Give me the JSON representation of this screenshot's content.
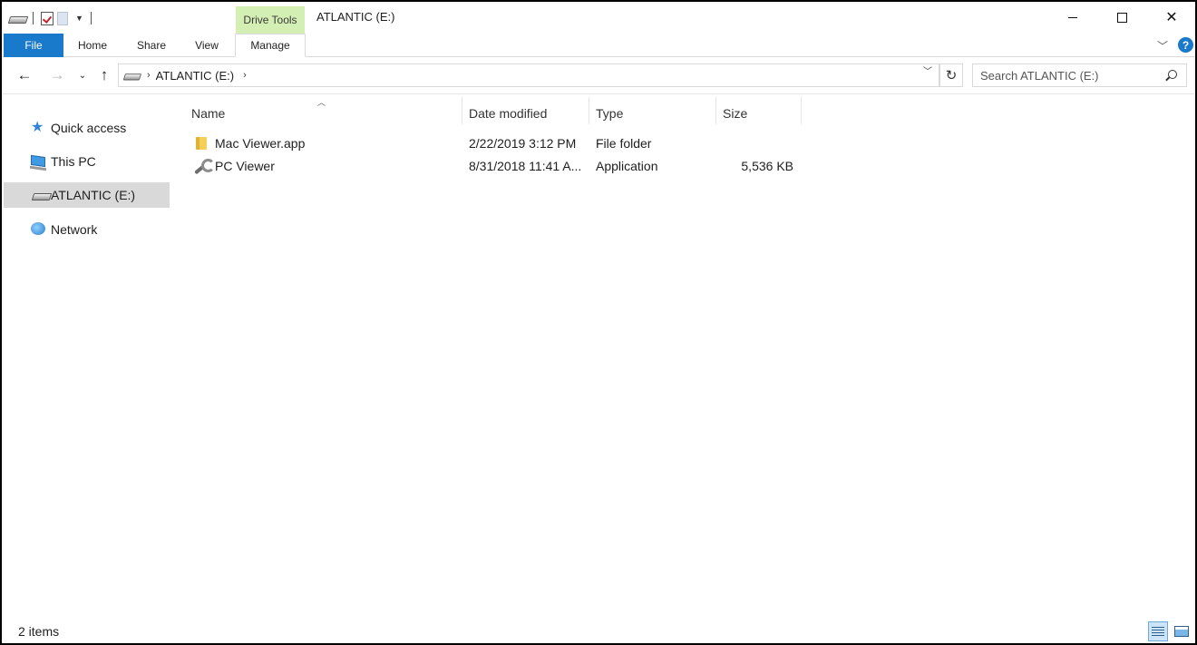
{
  "titlebar": {
    "context_tab": "Drive Tools",
    "window_title": "ATLANTIC (E:)"
  },
  "ribbon": {
    "tabs": [
      {
        "label": "File"
      },
      {
        "label": "Home"
      },
      {
        "label": "Share"
      },
      {
        "label": "View"
      },
      {
        "label": "Manage"
      }
    ],
    "help_label": "?"
  },
  "address": {
    "path": [
      "ATLANTIC (E:)"
    ],
    "search_placeholder": "Search ATLANTIC (E:)"
  },
  "nav_pane": {
    "items": [
      {
        "label": "Quick access",
        "icon": "star-icon"
      },
      {
        "label": "This PC",
        "icon": "computer-icon"
      },
      {
        "label": "ATLANTIC (E:)",
        "icon": "drive-icon",
        "selected": true
      },
      {
        "label": "Network",
        "icon": "network-icon"
      }
    ]
  },
  "file_list": {
    "columns": [
      "Name",
      "Date modified",
      "Type",
      "Size"
    ],
    "sort_column": "Name",
    "rows": [
      {
        "name": "Mac Viewer.app",
        "date": "2/22/2019 3:12 PM",
        "type": "File folder",
        "size": "",
        "icon": "folder-icon"
      },
      {
        "name": "PC Viewer",
        "date": "8/31/2018 11:41 A...",
        "type": "Application",
        "size": "5,536 KB",
        "icon": "application-icon"
      }
    ]
  },
  "status": {
    "item_count": "2 items",
    "active_view": "details"
  },
  "colors": {
    "accent": "#1979ca",
    "context_tab_bg": "#d4efb4",
    "selection_bg": "#d9d9d9"
  }
}
